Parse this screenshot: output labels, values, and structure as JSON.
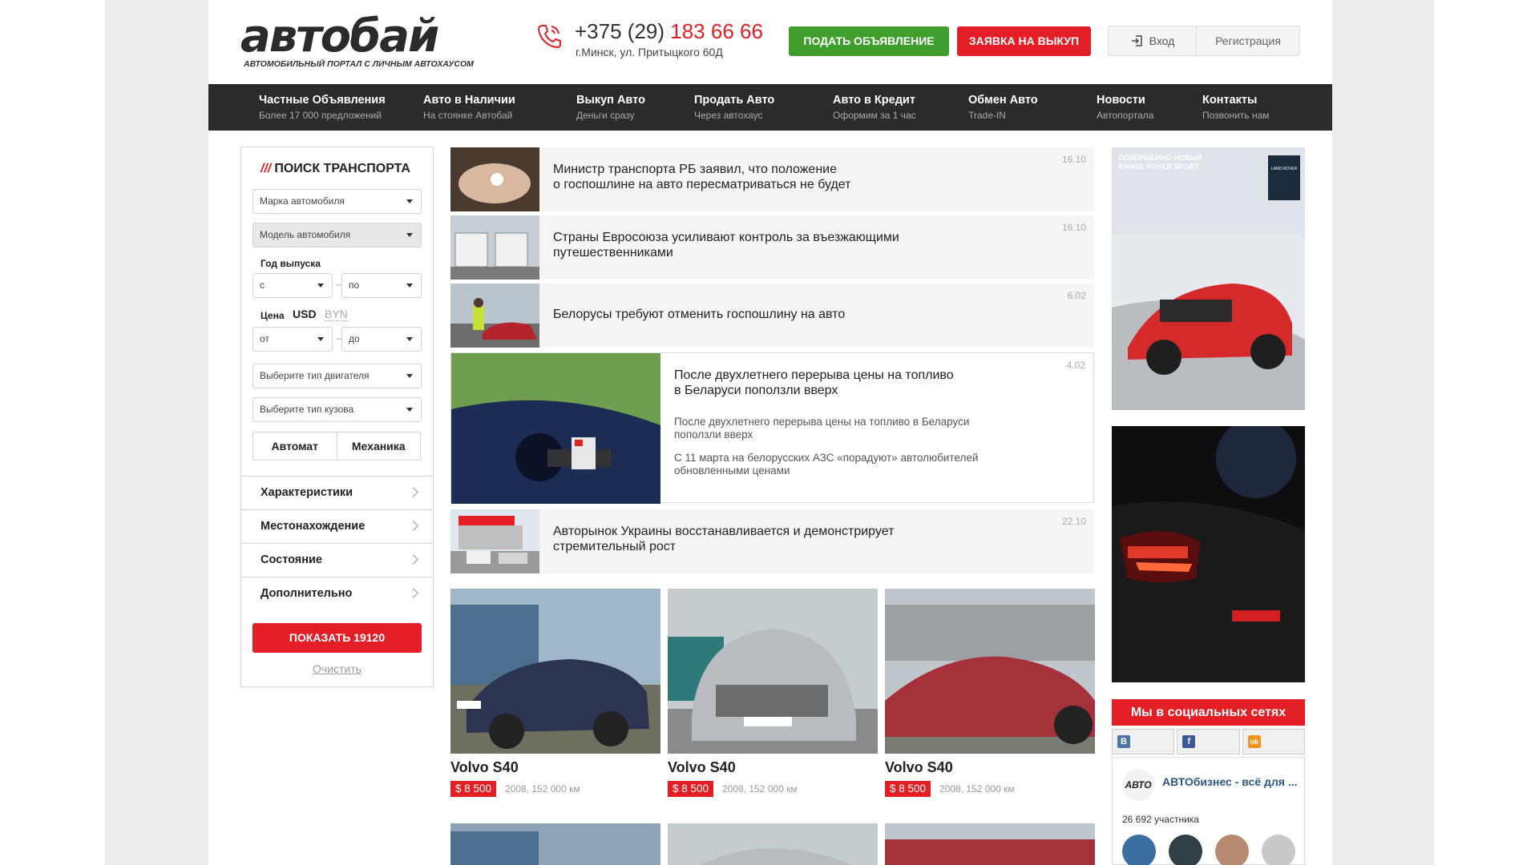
{
  "header": {
    "logo_text": "автобай",
    "logo_tagline": "АВТОМОБИЛЬНЫЙ ПОРТАЛ С ЛИЧНЫМ АВТОХАУСОМ",
    "phone_prefix": "+375 (29) ",
    "phone_number": "183 66 66",
    "address": "г.Минск, ул. Притыцкого 60Д",
    "post_ad_button": "ПОДАТЬ ОБЪЯВЛЕНИЕ",
    "buyout_button": "ЗАЯВКА НА ВЫКУП",
    "login": "Вход",
    "register": "Регистрация"
  },
  "nav": [
    {
      "title": "Частные Объявления",
      "sub": "Более 17 000 предложений"
    },
    {
      "title": "Авто в Наличии",
      "sub": "На стоянке Автобай"
    },
    {
      "title": "Выкуп Авто",
      "sub": "Деньги сразу"
    },
    {
      "title": "Продать Авто",
      "sub": "Через автохаус"
    },
    {
      "title": "Авто в Кредит",
      "sub": "Оформим за 1 час"
    },
    {
      "title": "Обмен Авто",
      "sub": "Trade-IN"
    },
    {
      "title": "Новости",
      "sub": "Автопортала"
    },
    {
      "title": "Контакты",
      "sub": "Позвонить нам"
    }
  ],
  "search": {
    "title_mark": "///",
    "title": "ПОИСК ТРАНСПОРТА",
    "make_placeholder": "Марка автомобиля",
    "model_placeholder": "Модель автомобиля",
    "year_label": "Год выпуска",
    "year_from": "с",
    "year_to": "по",
    "price_label": "Цена",
    "currency_usd": "USD",
    "currency_byn": "BYN",
    "price_from": "от",
    "price_to": "до",
    "engine_placeholder": "Выберите тип двигателя",
    "body_placeholder": "Выберите тип кузова",
    "dash": "–",
    "trans_auto": "Автомат",
    "trans_manual": "Механика",
    "sections": [
      "Характеристики",
      "Местонахождение",
      "Состояние",
      "Дополнительно"
    ],
    "show_button": "ПОКАЗАТЬ 19120",
    "clear_link": "Очистить"
  },
  "news": [
    {
      "title": "Министр транспорта РБ заявил, что положение\nо госпошлине на авто пересматриваться не будет",
      "date": "16.10"
    },
    {
      "title": "Страны Евросоюза усиливают контроль за въезжающими\nпутешественниками",
      "date": "16.10"
    },
    {
      "title": "Белорусы требуют отменить госпошлину на авто",
      "date": "6.02"
    },
    {
      "title": "Авторынок Украины восстанавливается и демонстрирует\nстремительный рост",
      "date": "22.10"
    }
  ],
  "featured_news": {
    "title": "После двухлетнего перерыва цены на топливо\nв Беларуси поползли вверх",
    "date": "4.02",
    "p1": "После двухлетнего перерыва цены на топливо в Беларуси поползли вверх",
    "p2": "С 11 марта на белорусских АЗС «порадуют» автолюбителей обновленными ценами"
  },
  "cars": [
    {
      "name": "Volvo S40",
      "price": "$ 8 500",
      "meta": "2008, 152 000 км"
    },
    {
      "name": "Volvo S40",
      "price": "$ 8 500",
      "meta": "2008, 152 000 км"
    },
    {
      "name": "Volvo S40",
      "price": "$ 8 500",
      "meta": "2008, 152 000 км"
    }
  ],
  "ad": {
    "rr_line1": "СОВЕРШЕННО НОВЫЙ",
    "rr_line2": "RANGE ROVER SPORT",
    "badge": "LAND ROVER"
  },
  "social": {
    "title": "Мы в социальных сетях",
    "vk": "В",
    "fb": "f",
    "ok": "ok",
    "group_logo": "АВТО",
    "group_name": "АВТОбизнес - всё для ...",
    "members": "26 692 участника"
  },
  "colors": {
    "accent_red": "#e31e24",
    "accent_green": "#3f9e2c",
    "nav_bg": "#2b2b2b"
  }
}
